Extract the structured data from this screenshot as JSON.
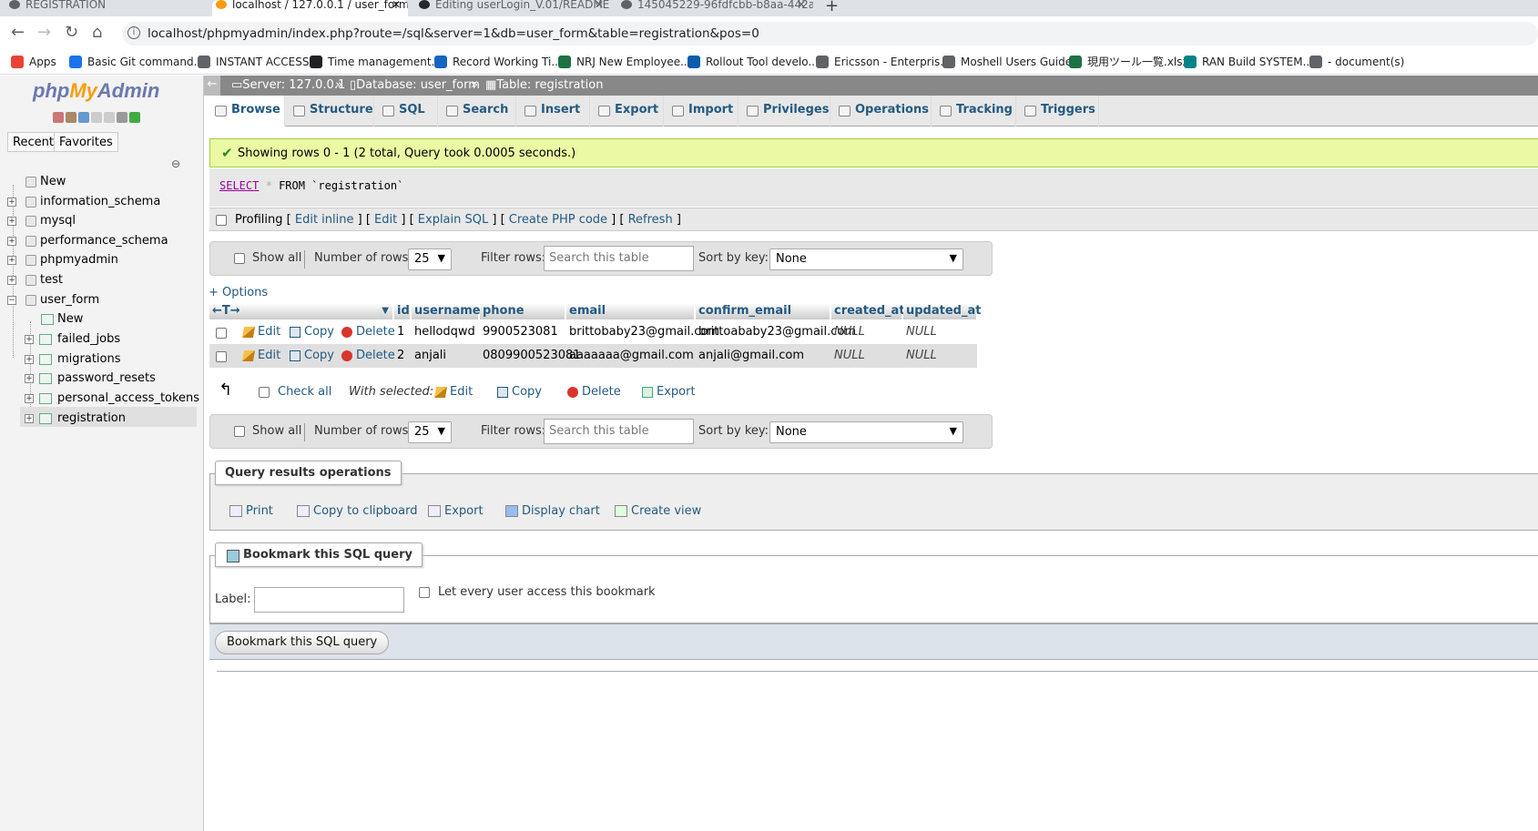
{
  "browser": {
    "tabs": [
      {
        "label": "REGISTRATION",
        "active": false
      },
      {
        "label": "localhost / 127.0.0.1 / user_form",
        "active": true
      },
      {
        "label": "Editing userLogin_V.01/README",
        "active": false
      },
      {
        "label": "145045229-96fdfcbb-b8aa-442a",
        "active": false
      }
    ],
    "new_tab": "+",
    "url": "localhost/phpmyadmin/index.php?route=/sql&server=1&db=user_form&table=registration&pos=0",
    "bookmarks": [
      {
        "label": "Apps",
        "color": "#ea4335"
      },
      {
        "label": "Basic Git command...",
        "color": "#1a73e8"
      },
      {
        "label": "INSTANT ACCESS",
        "color": "#5f6368"
      },
      {
        "label": "Time management...",
        "color": "#202124"
      },
      {
        "label": "Record Working Ti...",
        "color": "#1565c0"
      },
      {
        "label": "NRJ New Employee...",
        "color": "#1e7145"
      },
      {
        "label": "Rollout Tool develo...",
        "color": "#0b5cad"
      },
      {
        "label": "Ericsson - Enterpris...",
        "color": "#5f6368"
      },
      {
        "label": "Moshell Users Guide",
        "color": "#5f6368"
      },
      {
        "label": "現用ツール一覧.xlsx",
        "color": "#1e7145"
      },
      {
        "label": "RAN Build SYSTEM...",
        "color": "#038387"
      },
      {
        "label": "- document(s)",
        "color": "#5f6368"
      }
    ]
  },
  "sidebar": {
    "logo_php": "php",
    "logo_my": "My",
    "logo_admin": "Admin",
    "tab_recent": "Recent",
    "tab_favorites": "Favorites",
    "tree": {
      "new": "New",
      "databases": [
        "information_schema",
        "mysql",
        "performance_schema",
        "phpmyadmin",
        "test"
      ],
      "open_db": "user_form",
      "open_db_new": "New",
      "tables": [
        "failed_jobs",
        "migrations",
        "password_resets",
        "personal_access_tokens",
        "registration"
      ]
    }
  },
  "breadcrumb": {
    "server": "Server: 127.0.0.1",
    "database": "Database: user_form",
    "table": "Table: registration",
    "sep": "»"
  },
  "tabs": [
    "Browse",
    "Structure",
    "SQL",
    "Search",
    "Insert",
    "Export",
    "Import",
    "Privileges",
    "Operations",
    "Tracking",
    "Triggers"
  ],
  "message": "Showing rows 0 - 1 (2 total, Query took 0.0005 seconds.)",
  "sql": {
    "keyword": "SELECT",
    "star": "*",
    "rest": "FROM `registration`"
  },
  "profiling": {
    "label": "Profiling",
    "links": [
      "Edit inline",
      "Edit",
      "Explain SQL",
      "Create PHP code",
      "Refresh"
    ]
  },
  "navbar": {
    "show_all": "Show all",
    "num_rows_label": "Number of rows:",
    "num_rows_value": "25",
    "filter_label": "Filter rows:",
    "filter_placeholder": "Search this table",
    "sort_label": "Sort by key:",
    "sort_value": "None"
  },
  "options_link": "+ Options",
  "table": {
    "arrows": "←T→",
    "columns": [
      "id",
      "username",
      "phone",
      "email",
      "confirm_email",
      "created_at",
      "updated_at"
    ],
    "actions": {
      "edit": "Edit",
      "copy": "Copy",
      "delete": "Delete"
    },
    "rows": [
      {
        "id": "1",
        "username": "hellodqwd",
        "phone": "9900523081",
        "email": "brittobaby23@gmail.com",
        "confirm_email": "brittoababy23@gmail.com",
        "created_at": "NULL",
        "updated_at": "NULL"
      },
      {
        "id": "2",
        "username": "anjali",
        "phone": "0809900523081",
        "email": "aaaaaaa@gmail.com",
        "confirm_email": "anjali@gmail.com",
        "created_at": "NULL",
        "updated_at": "NULL"
      }
    ]
  },
  "with_selected": {
    "check_all": "Check all",
    "label": "With selected:",
    "edit": "Edit",
    "copy": "Copy",
    "delete": "Delete",
    "export": "Export"
  },
  "query_ops": {
    "legend": "Query results operations",
    "print": "Print",
    "copy": "Copy to clipboard",
    "export": "Export",
    "chart": "Display chart",
    "view": "Create view"
  },
  "bookmark": {
    "legend": "Bookmark this SQL query",
    "label": "Label:",
    "every_user": "Let every user access this bookmark",
    "button": "Bookmark this SQL query"
  }
}
